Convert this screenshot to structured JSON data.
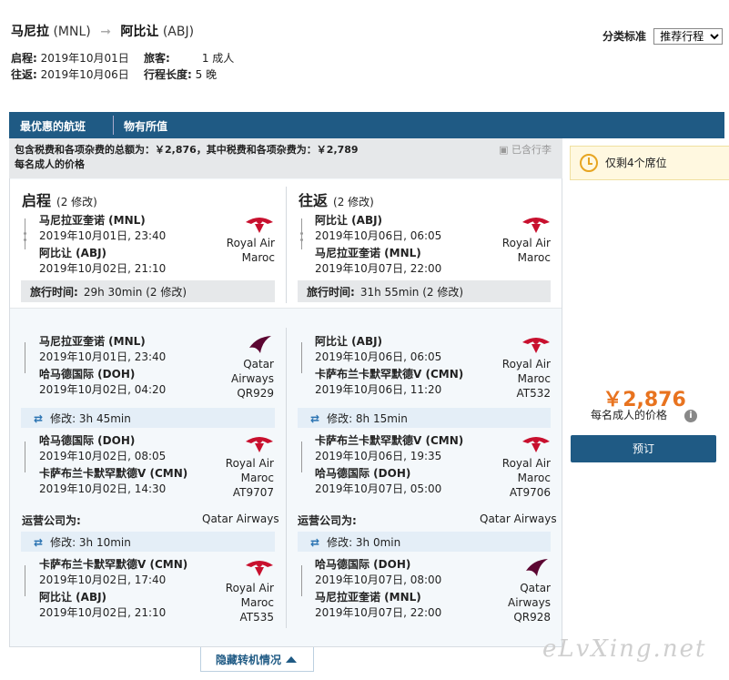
{
  "header": {
    "from_city": "马尼拉",
    "from_code": "(MNL)",
    "to_city": "阿比让",
    "to_code": "(ABJ)"
  },
  "meta": {
    "depart_label": "启程:",
    "depart_value": "2019年10月01日",
    "return_label": "往返:",
    "return_value": "2019年10月06日",
    "pax_label": "旅客:",
    "pax_value": "1 成人",
    "length_label": "行程长度:",
    "length_value": "5 晚"
  },
  "sort": {
    "label": "分类标准",
    "selected": "推荐行程"
  },
  "tabs": [
    "最优惠的航班",
    "物有所值"
  ],
  "summary": {
    "line1": "包含税费和各项杂费的总额为：￥2,876，其中税费和各项杂费为：￥2,789",
    "line2": "每名成人的价格",
    "luggage": "已含行李"
  },
  "outbound": {
    "title": "启程",
    "stops": "(2 修改)",
    "dep_place": "马尼拉亚奎诺 (MNL)",
    "dep_time": "2019年10月01日, 23:40",
    "arr_place": "阿比让 (ABJ)",
    "arr_time": "2019年10月02日, 21:10",
    "airline": "Royal Air Maroc",
    "travel_label": "旅行时间:",
    "travel_value": "29h 30min (2 修改)"
  },
  "inbound": {
    "title": "往返",
    "stops": "(2 修改)",
    "dep_place": "阿比让 (ABJ)",
    "dep_time": "2019年10月06日, 06:05",
    "arr_place": "马尼拉亚奎诺 (MNL)",
    "arr_time": "2019年10月07日, 22:00",
    "airline": "Royal Air Maroc",
    "travel_label": "旅行时间:",
    "travel_value": "31h 55min (2 修改)"
  },
  "out_segments": [
    {
      "dep_place": "马尼拉亚奎诺 (MNL)",
      "dep_time": "2019年10月01日, 23:40",
      "arr_place": "哈马德国际 (DOH)",
      "arr_time": "2019年10月02日, 04:20",
      "airline1": "Qatar",
      "airline2": "Airways",
      "flight": "QR929"
    },
    {
      "dep_place": "哈马德国际 (DOH)",
      "dep_time": "2019年10月02日, 08:05",
      "arr_place": "卡萨布兰卡默罕默德V (CMN)",
      "arr_time": "2019年10月02日, 14:30",
      "airline1": "Royal Air",
      "airline2": "Maroc",
      "flight": "AT9707"
    },
    {
      "dep_place": "卡萨布兰卡默罕默德V (CMN)",
      "dep_time": "2019年10月02日, 17:40",
      "arr_place": "阿比让 (ABJ)",
      "arr_time": "2019年10月02日, 21:10",
      "airline1": "Royal Air",
      "airline2": "Maroc",
      "flight": "AT535"
    }
  ],
  "out_conn": [
    "修改: 3h 45min",
    "修改: 3h 10min"
  ],
  "out_oper": {
    "label": "运营公司为:",
    "value": "Qatar Airways"
  },
  "in_segments": [
    {
      "dep_place": "阿比让 (ABJ)",
      "dep_time": "2019年10月06日, 06:05",
      "arr_place": "卡萨布兰卡默罕默德V (CMN)",
      "arr_time": "2019年10月06日, 11:20",
      "airline1": "Royal Air",
      "airline2": "Maroc",
      "flight": "AT532"
    },
    {
      "dep_place": "卡萨布兰卡默罕默德V (CMN)",
      "dep_time": "2019年10月06日, 19:35",
      "arr_place": "哈马德国际 (DOH)",
      "arr_time": "2019年10月07日, 05:00",
      "airline1": "Royal Air",
      "airline2": "Maroc",
      "flight": "AT9706"
    },
    {
      "dep_place": "哈马德国际 (DOH)",
      "dep_time": "2019年10月07日, 08:00",
      "arr_place": "马尼拉亚奎诺 (MNL)",
      "arr_time": "2019年10月07日, 22:00",
      "airline1": "Qatar",
      "airline2": "Airways",
      "flight": "QR928"
    }
  ],
  "in_conn": [
    "修改: 8h 15min",
    "修改: 3h 0min"
  ],
  "in_oper": {
    "label": "运营公司为:",
    "value": "Qatar Airways"
  },
  "side": {
    "seats": "仅剩4个席位",
    "price": "￥2,876",
    "per_adult": "每名成人的价格",
    "book": "预订",
    "info": "i"
  },
  "hide_label": "隐藏转机情况",
  "watermark": "eLvXing.net",
  "colors": {
    "brand": "#1f5a84",
    "price": "#e8731f",
    "royal_air_maroc": "#c8102e",
    "qatar": "#5c0632"
  }
}
